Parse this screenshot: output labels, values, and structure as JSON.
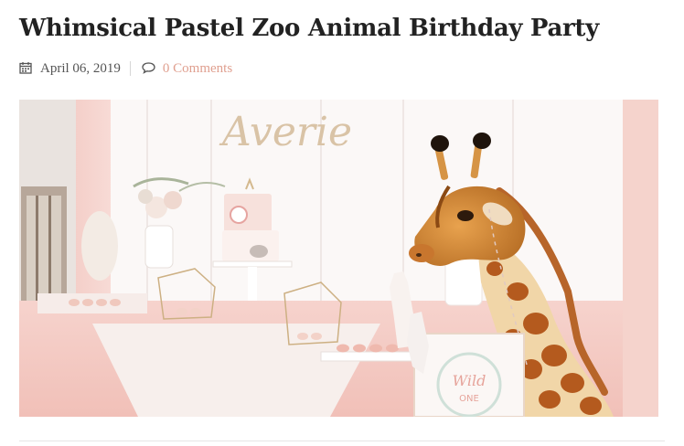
{
  "post": {
    "title": "Whimsical Pastel Zoo Animal Birthday Party",
    "date": "April 06, 2019",
    "comments_link": "0 Comments",
    "date_icon": "calendar-icon",
    "comments_icon": "comment-bubble-icon"
  },
  "hero_image": {
    "backdrop_name": "Averie",
    "sign_line1": "Wild",
    "sign_line2": "ONE"
  },
  "colors": {
    "title": "#222222",
    "meta_text": "#555555",
    "link_accent": "#e0a090"
  }
}
